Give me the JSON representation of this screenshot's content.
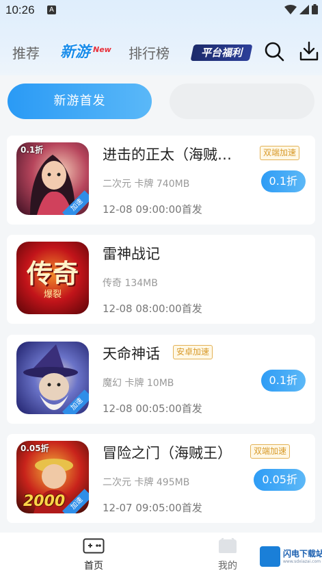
{
  "status_bar": {
    "time": "10:26",
    "notification_letter": "A"
  },
  "top_nav": {
    "tabs": [
      "推荐",
      "新游",
      "排行榜"
    ],
    "new_badge": "New",
    "welfare_label": "平台福利",
    "search_icon": "search-icon",
    "download_icon": "download-icon"
  },
  "sub_tabs": {
    "active": "新游首发",
    "inactive": ""
  },
  "games": [
    {
      "title": "进击的正太（海贼…",
      "tag": "双端加速",
      "meta": "二次元 卡牌 740MB",
      "date": "12-08 09:00:00首发",
      "discount": "0.1折",
      "icon_corner": "0.1折",
      "icon_accel": "加速"
    },
    {
      "title": "雷神战记",
      "tag": "",
      "meta": "传奇 134MB",
      "date": "12-08 08:00:00首发",
      "discount": "",
      "icon_corner": "",
      "icon_accel": ""
    },
    {
      "title": "天命神话",
      "tag": "安卓加速",
      "meta": "魔幻 卡牌 10MB",
      "date": "12-08 00:05:00首发",
      "discount": "0.1折",
      "icon_corner": "",
      "icon_accel": "加速"
    },
    {
      "title": "冒险之门（海贼王）",
      "tag": "双端加速",
      "meta": "二次元 卡牌 495MB",
      "date": "12-07 09:05:00首发",
      "discount": "0.05折",
      "icon_corner": "0.05折",
      "icon_accel": "加速"
    }
  ],
  "game2_icon_text": {
    "main": "传奇",
    "sub": "爆裂"
  },
  "game4_icon_number": "2000",
  "bottom_nav": {
    "home": "首页",
    "mine": "我的"
  },
  "watermark": {
    "name": "闪电下载站",
    "url": "www.sdxiazai.com"
  },
  "colors": {
    "accent": "#2a9af5",
    "tag_border": "#e3b154",
    "tag_text": "#d89a2a"
  }
}
